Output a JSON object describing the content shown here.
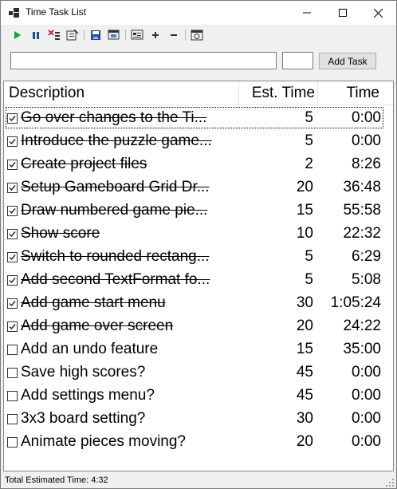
{
  "window": {
    "title": "Time Task List"
  },
  "toolbar": {
    "icons": [
      "play-icon",
      "pause-icon",
      "delete-done-icon",
      "clear-list-icon",
      "save-icon",
      "open-icon",
      "details-icon",
      "plus-icon",
      "minus-icon",
      "timer-icon"
    ]
  },
  "input": {
    "task_value": "",
    "time_value": "",
    "add_label": "Add Task"
  },
  "list": {
    "headers": {
      "description": "Description",
      "est": "Est. Time",
      "time": "Time"
    },
    "rows": [
      {
        "done": true,
        "description": "Go over changes to the Ti...",
        "est": "5",
        "time": "0:00"
      },
      {
        "done": true,
        "description": "Introduce the puzzle game...",
        "est": "5",
        "time": "0:00"
      },
      {
        "done": true,
        "description": "Create project files",
        "est": "2",
        "time": "8:26"
      },
      {
        "done": true,
        "description": "Setup Gameboard Grid Dr...",
        "est": "20",
        "time": "36:48"
      },
      {
        "done": true,
        "description": "Draw numbered game pie...",
        "est": "15",
        "time": "55:58"
      },
      {
        "done": true,
        "description": "Show score",
        "est": "10",
        "time": "22:32"
      },
      {
        "done": true,
        "description": "Switch to rounded rectang...",
        "est": "5",
        "time": "6:29"
      },
      {
        "done": true,
        "description": "Add second TextFormat fo...",
        "est": "5",
        "time": "5:08"
      },
      {
        "done": true,
        "description": "Add game start menu",
        "est": "30",
        "time": "1:05:24"
      },
      {
        "done": true,
        "description": "Add game over screen",
        "est": "20",
        "time": "24:22"
      },
      {
        "done": false,
        "description": "Add an undo feature",
        "est": "15",
        "time": "35:00"
      },
      {
        "done": false,
        "description": "Save high scores?",
        "est": "45",
        "time": "0:00"
      },
      {
        "done": false,
        "description": "Add settings menu?",
        "est": "45",
        "time": "0:00"
      },
      {
        "done": false,
        "description": "3x3 board setting?",
        "est": "30",
        "time": "0:00"
      },
      {
        "done": false,
        "description": "Animate pieces moving?",
        "est": "20",
        "time": "0:00"
      }
    ]
  },
  "status": {
    "text": "Total Estimated Time: 4:32"
  },
  "colors": {
    "play": "#1e9e3e",
    "pause": "#1a4fa3",
    "delete": "#d32f2f",
    "save": "#1a4fa3"
  }
}
